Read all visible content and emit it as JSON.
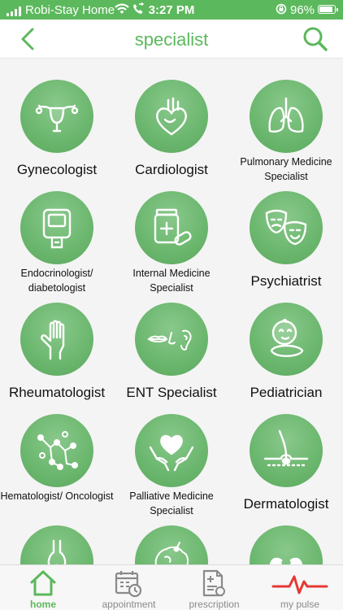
{
  "status_bar": {
    "carrier": "Robi-Stay Home",
    "time": "3:27 PM",
    "battery_pct": "96%",
    "battery_level": 0.96,
    "icons": [
      "signal-icon",
      "wifi-icon",
      "call-forward-icon",
      "orientation-lock-icon",
      "battery-icon"
    ]
  },
  "header": {
    "title": "specialist",
    "back_icon": "chevron-left-icon",
    "search_icon": "search-icon"
  },
  "specialists": [
    {
      "label": "Gynecologist",
      "icon": "uterus-icon",
      "size": "big"
    },
    {
      "label": "Cardiologist",
      "icon": "heart-icon",
      "size": "big"
    },
    {
      "label": "Pulmonary Medicine Specialist",
      "icon": "lungs-icon",
      "size": "small"
    },
    {
      "label": "Endocrinologist/ diabetologist",
      "icon": "glucose-meter-icon",
      "size": "small"
    },
    {
      "label": "Internal Medicine Specialist",
      "icon": "medicine-icon",
      "size": "small"
    },
    {
      "label": "Psychiatrist",
      "icon": "theater-masks-icon",
      "size": "big"
    },
    {
      "label": "Rheumatologist",
      "icon": "hand-icon",
      "size": "big"
    },
    {
      "label": "ENT Specialist",
      "icon": "ear-nose-throat-icon",
      "size": "big"
    },
    {
      "label": "Pediatrician",
      "icon": "baby-icon",
      "size": "big"
    },
    {
      "label": "Hematologist/ Oncologist",
      "icon": "blood-cells-icon",
      "size": "small"
    },
    {
      "label": "Palliative Medicine Specialist",
      "icon": "hands-heart-icon",
      "size": "small"
    },
    {
      "label": "Dermatologist",
      "icon": "skin-hair-icon",
      "size": "big"
    },
    {
      "label": "",
      "icon": "bone-icon",
      "size": "big"
    },
    {
      "label": "",
      "icon": "brain-icon",
      "size": "big"
    },
    {
      "label": "",
      "icon": "kidney-icon",
      "size": "big"
    }
  ],
  "tabs": [
    {
      "label": "home",
      "icon": "home-icon",
      "active": true
    },
    {
      "label": "appointment",
      "icon": "calendar-clock-icon",
      "active": false
    },
    {
      "label": "prescription",
      "icon": "prescription-icon",
      "active": false
    },
    {
      "label": "my pulse",
      "icon": "pulse-icon",
      "active": false
    }
  ],
  "colors": {
    "brand": "#5cb85c",
    "icon_circle": "#6db870",
    "pulse": "#e53935",
    "tab_inactive": "#8a8a8a"
  }
}
